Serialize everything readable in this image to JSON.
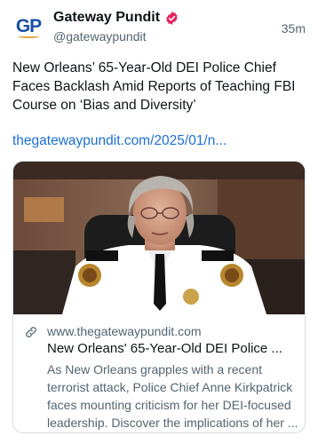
{
  "author": {
    "display_name": "Gateway Pundit",
    "handle": "@gatewaypundit",
    "avatar_text": "GP",
    "verified_icon": "verified-badge-icon",
    "badge_color": "#e0245e"
  },
  "post": {
    "timestamp": "35m",
    "text": "New Orleans’ 65-Year-Old DEI Police Chief Faces Backlash Amid Reports of Teaching FBI Course on ‘Bias and Diversity’",
    "link": "thegatewaypundit.com/2025/01/n..."
  },
  "card": {
    "domain": "www.thegatewaypundit.com",
    "title": "New Orleans' 65-Year-Old DEI Police ...",
    "description": "As New Orleans grapples with a recent terrorist attack, Police Chief Anne Kirkpatrick faces mounting criticism for her DEI-focused leadership. Discover the implications of her ...",
    "link_icon": "link-icon"
  },
  "colors": {
    "link": "#1d6fd0",
    "secondary_text": "#536471",
    "primary_text": "#0f1419"
  }
}
